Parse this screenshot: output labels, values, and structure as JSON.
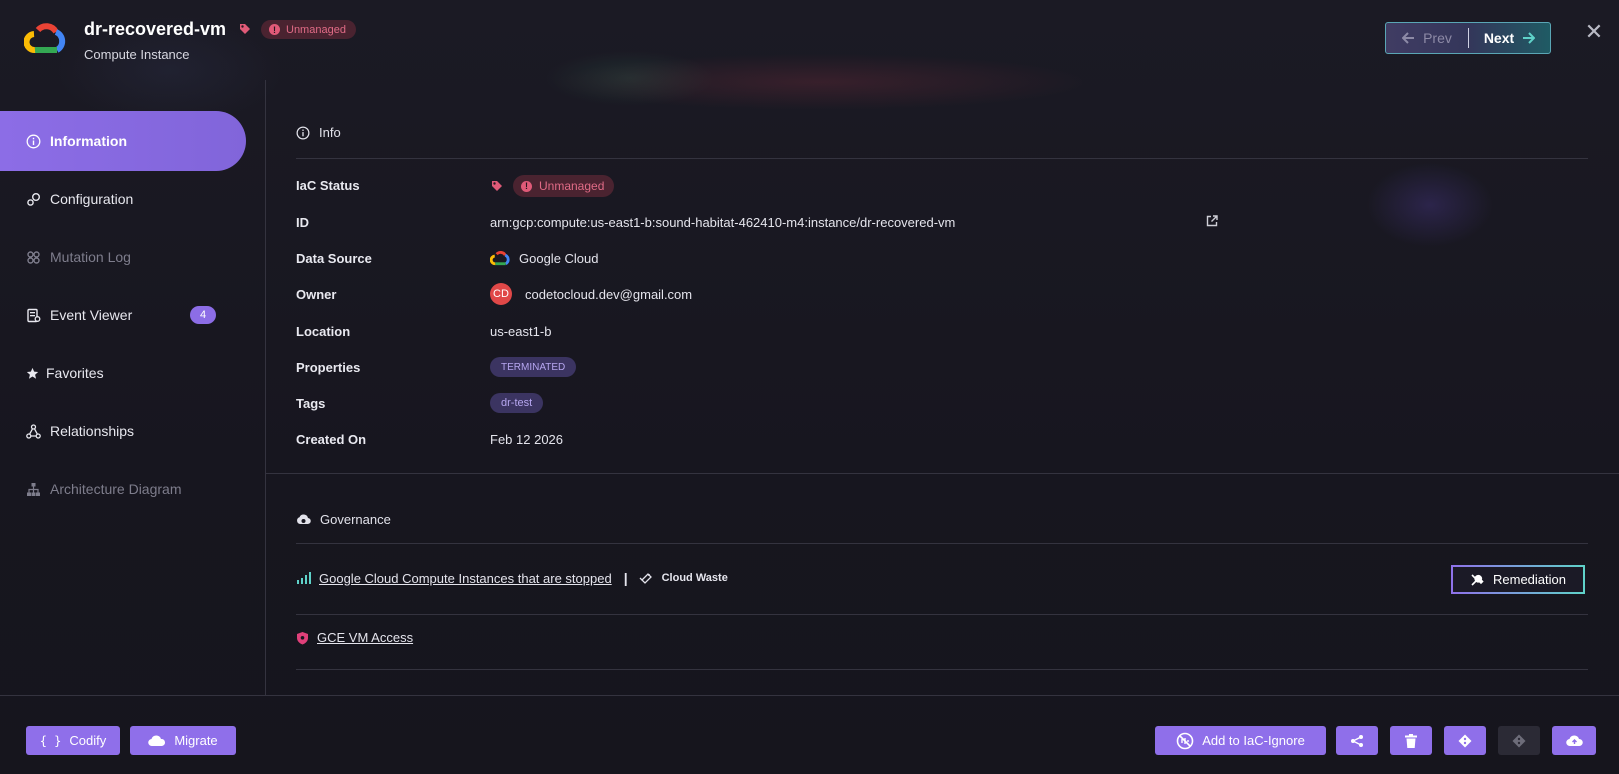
{
  "header": {
    "title": "dr-recovered-vm",
    "subtitle": "Compute Instance",
    "status_badge": "Unmanaged",
    "prev_label": "Prev",
    "next_label": "Next"
  },
  "sidebar": {
    "items": [
      {
        "label": "Information",
        "icon": "info-icon"
      },
      {
        "label": "Configuration",
        "icon": "config-icon"
      },
      {
        "label": "Mutation Log",
        "icon": "mutation-log-icon"
      },
      {
        "label": "Event Viewer",
        "icon": "event-viewer-icon",
        "count": "4"
      },
      {
        "label": "Favorites",
        "icon": "star-icon"
      },
      {
        "label": "Relationships",
        "icon": "relationships-icon"
      },
      {
        "label": "Architecture Diagram",
        "icon": "architecture-icon"
      }
    ]
  },
  "info": {
    "section_title": "Info",
    "rows": {
      "iac_status": {
        "label": "IaC Status",
        "value": "Unmanaged"
      },
      "id": {
        "label": "ID",
        "value": "arn:gcp:compute:us-east1-b:sound-habitat-462410-m4:instance/dr-recovered-vm"
      },
      "data_source": {
        "label": "Data Source",
        "value": "Google Cloud"
      },
      "owner": {
        "label": "Owner",
        "initials": "CD",
        "value": "codetocloud.dev@gmail.com"
      },
      "location": {
        "label": "Location",
        "value": "us-east1-b"
      },
      "properties": {
        "label": "Properties",
        "value": "TERMINATED"
      },
      "tags": {
        "label": "Tags",
        "value": "dr-test"
      },
      "created_on": {
        "label": "Created On",
        "value": "Feb 12 2026"
      }
    }
  },
  "governance": {
    "section_title": "Governance",
    "policies": [
      {
        "title": "Google Cloud Compute Instances that are stopped",
        "separator": "|",
        "category": "Cloud Waste",
        "action": "Remediation"
      },
      {
        "title": "GCE VM Access"
      }
    ]
  },
  "footer": {
    "codify": "Codify",
    "migrate": "Migrate",
    "add_iac_ignore": "Add to IaC-Ignore"
  },
  "colors": {
    "accent": "#8f6fea",
    "unmanaged": "#e06b86",
    "teal": "#5fd2c9"
  }
}
